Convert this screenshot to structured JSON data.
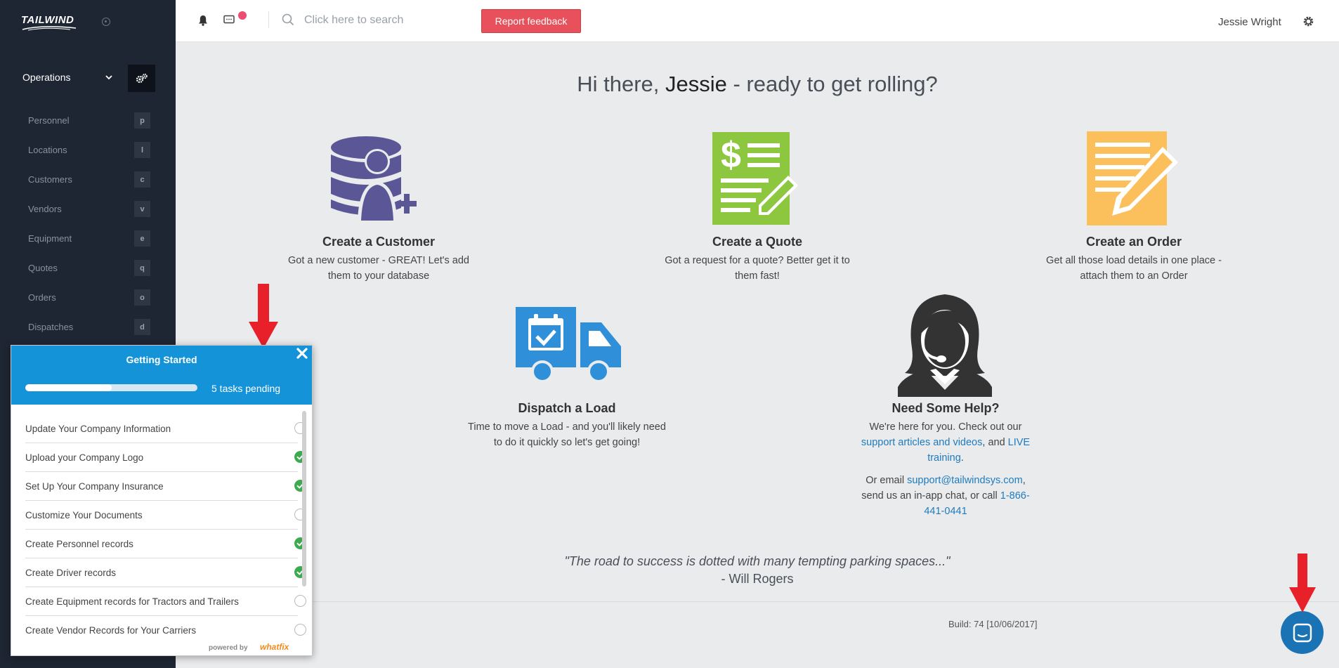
{
  "app": {
    "logo_text": "TAILWIND"
  },
  "sidebar": {
    "section_label": "Operations",
    "items": [
      {
        "label": "Personnel",
        "key": "p"
      },
      {
        "label": "Locations",
        "key": "l"
      },
      {
        "label": "Customers",
        "key": "c"
      },
      {
        "label": "Vendors",
        "key": "v"
      },
      {
        "label": "Equipment",
        "key": "e"
      },
      {
        "label": "Quotes",
        "key": "q"
      },
      {
        "label": "Orders",
        "key": "o"
      },
      {
        "label": "Dispatches",
        "key": "d"
      }
    ]
  },
  "topbar": {
    "search_placeholder": "Click here to search",
    "feedback_label": "Report feedback",
    "user_name": "Jessie Wright"
  },
  "greeting": {
    "prefix": "Hi there, ",
    "name": "Jessie",
    "suffix": " - ready to get rolling?"
  },
  "cards": {
    "customer": {
      "title": "Create a Customer",
      "desc": "Got a new customer - GREAT! Let's add them to your database",
      "icon": "database-user-add-icon"
    },
    "quote": {
      "title": "Create a Quote",
      "desc": "Got a request for a quote? Better get it to them fast!",
      "icon": "quote-document-icon"
    },
    "order": {
      "title": "Create an Order",
      "desc": "Get all those load details in one place - attach them to an Order",
      "icon": "order-document-icon"
    },
    "dispatch": {
      "title": "Dispatch a Load",
      "desc": "Time to move a Load - and you'll likely need to do it quickly so let's get going!",
      "icon": "truck-icon"
    },
    "help": {
      "title": "Need Some Help?",
      "line1": "We're here for you. Check out our ",
      "link1": "support articles and videos",
      "line1b": ", and ",
      "link2": "LIVE training",
      "line1c": ".",
      "line2": "Or email ",
      "email": "support@tailwindsys.com",
      "line2b": ", send us an in-app chat, or call ",
      "phone": "1-866-441-0441",
      "icon": "support-agent-icon"
    }
  },
  "quote": {
    "text": "\"The road to success is dotted with many tempting parking spaces...\"",
    "author": "- Will Rogers"
  },
  "footer": {
    "build": "Build: 74 [10/06/2017]"
  },
  "getting_started": {
    "title": "Getting Started",
    "pending_text": "5 tasks pending",
    "progress_fraction": 0.5,
    "items": [
      {
        "label": "Update Your Company Information",
        "done": false
      },
      {
        "label": "Upload your Company Logo",
        "done": true
      },
      {
        "label": "Set Up Your Company Insurance",
        "done": true
      },
      {
        "label": "Customize Your Documents",
        "done": false
      },
      {
        "label": "Create Personnel records",
        "done": true
      },
      {
        "label": "Create Driver records",
        "done": true
      },
      {
        "label": "Create Equipment records for Tractors and Trailers",
        "done": false
      },
      {
        "label": "Create Vendor Records for Your Carriers",
        "done": false
      }
    ],
    "powered_by": "powered by",
    "powered_brand": "whatfix"
  },
  "colors": {
    "sidebar_bg": "#1f2633",
    "accent_blue": "#1593d8",
    "feedback_red": "#e8505b",
    "customer_purple": "#5b5796",
    "quote_green": "#8dc63f",
    "order_yellow": "#fbbf5c",
    "truck_blue": "#2f8fd8",
    "help_dark": "#333333"
  }
}
